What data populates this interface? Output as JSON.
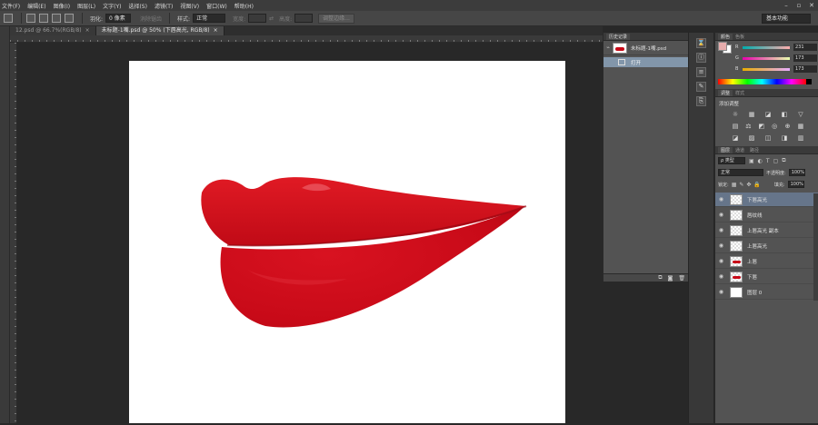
{
  "menu": [
    "文件(F)",
    "编辑(E)",
    "图像(I)",
    "图层(L)",
    "文字(Y)",
    "选择(S)",
    "滤镜(T)",
    "视图(V)",
    "窗口(W)",
    "帮助(H)"
  ],
  "options": {
    "feather_label": "羽化:",
    "feather_value": "0 像素",
    "antialias_label": "消除锯齿",
    "style_label": "样式:",
    "style_value": "正常",
    "width_label": "宽度:",
    "height_label": "高度:",
    "refine_button": "调整边缘...",
    "workspace": "基本功能"
  },
  "tabs": [
    {
      "label": "12.psd @ 66.7%(RGB/8)",
      "close": "×",
      "active": false
    },
    {
      "label": "未标题-1嘴.psd @ 50% (下唇高光, RGB/8)",
      "close": "×",
      "active": true
    }
  ],
  "history": {
    "tab": "历史记录",
    "snapshot": "未标题-1嘴.psd",
    "items": [
      "打开"
    ]
  },
  "color": {
    "tabs": [
      "颜色",
      "色板"
    ],
    "channels": [
      {
        "label": "R",
        "value": "231"
      },
      {
        "label": "G",
        "value": "173"
      },
      {
        "label": "B",
        "value": "173"
      }
    ],
    "fg": "#e7adad",
    "bg": "#ffffff"
  },
  "adjustments": {
    "tabs": [
      "调整",
      "样式"
    ],
    "title": "添加调整"
  },
  "layers": {
    "tabs": [
      "图层",
      "通道",
      "路径"
    ],
    "kind": "ρ 类型",
    "blend_mode": "正常",
    "opacity_label": "不透明度:",
    "opacity": "100%",
    "lock_label": "锁定:",
    "fill_label": "填充:",
    "fill": "100%",
    "items": [
      {
        "name": "下唇高光",
        "selected": true,
        "thumb": "transparent"
      },
      {
        "name": "唇纹线",
        "selected": false,
        "thumb": "transparent"
      },
      {
        "name": "上唇高光 副本",
        "selected": false,
        "thumb": "transparent"
      },
      {
        "name": "上唇高光",
        "selected": false,
        "thumb": "transparent"
      },
      {
        "name": "上唇",
        "selected": false,
        "thumb": "lip"
      },
      {
        "name": "下唇",
        "selected": false,
        "thumb": "lip"
      },
      {
        "name": "图层 0",
        "selected": false,
        "thumb": "white"
      }
    ]
  },
  "icons": {
    "eye": "👁",
    "lock": "🔒",
    "link": "∞",
    "new": "⊞",
    "trash": "🗑"
  }
}
